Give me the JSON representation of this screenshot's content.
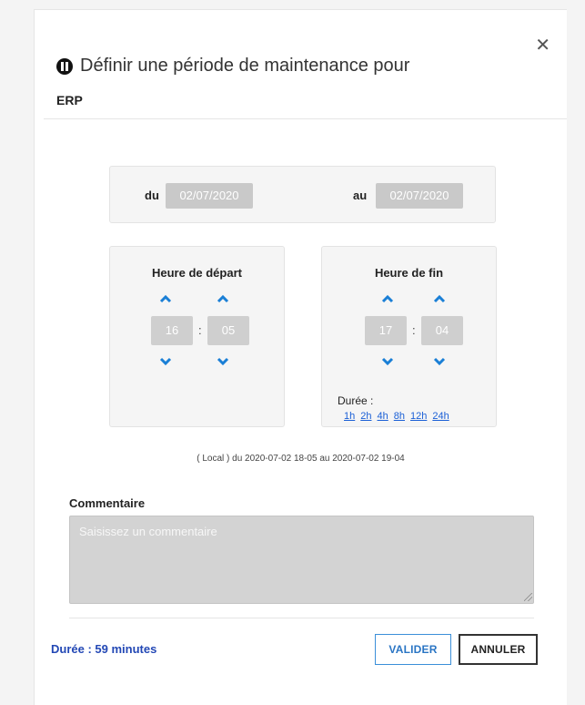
{
  "dialog": {
    "title": "Définir une période de maintenance pour",
    "subtitle": "ERP",
    "close_label": "✕"
  },
  "dates": {
    "from_label": "du",
    "from_value": "02/07/2020",
    "to_label": "au",
    "to_value": "02/07/2020"
  },
  "start_time": {
    "title": "Heure de départ",
    "hours": "16",
    "separator": ":",
    "minutes": "05"
  },
  "end_time": {
    "title": "Heure de fin",
    "hours": "17",
    "separator": ":",
    "minutes": "04",
    "duration_label": "Durée :",
    "quick_durations": [
      "1h",
      "2h",
      "4h",
      "8h",
      "12h",
      "24h"
    ]
  },
  "local_range": "( Local ) du 2020-07-02 18-05 au 2020-07-02 19-04",
  "comment": {
    "label": "Commentaire",
    "placeholder": "Saisissez un commentaire",
    "value": ""
  },
  "footer": {
    "duration_text": "Durée : 59 minutes",
    "validate_label": "VALIDER",
    "cancel_label": "ANNULER"
  },
  "colors": {
    "accent": "#1a7fd6",
    "duration_text": "#2348b5",
    "panel_bg": "#f5f5f5",
    "input_bg": "#c9c9c9"
  },
  "icons": {
    "title_icon": "pause-circle-icon",
    "increment": "chevron-up-icon",
    "decrement": "chevron-down-icon",
    "close": "close-icon"
  }
}
